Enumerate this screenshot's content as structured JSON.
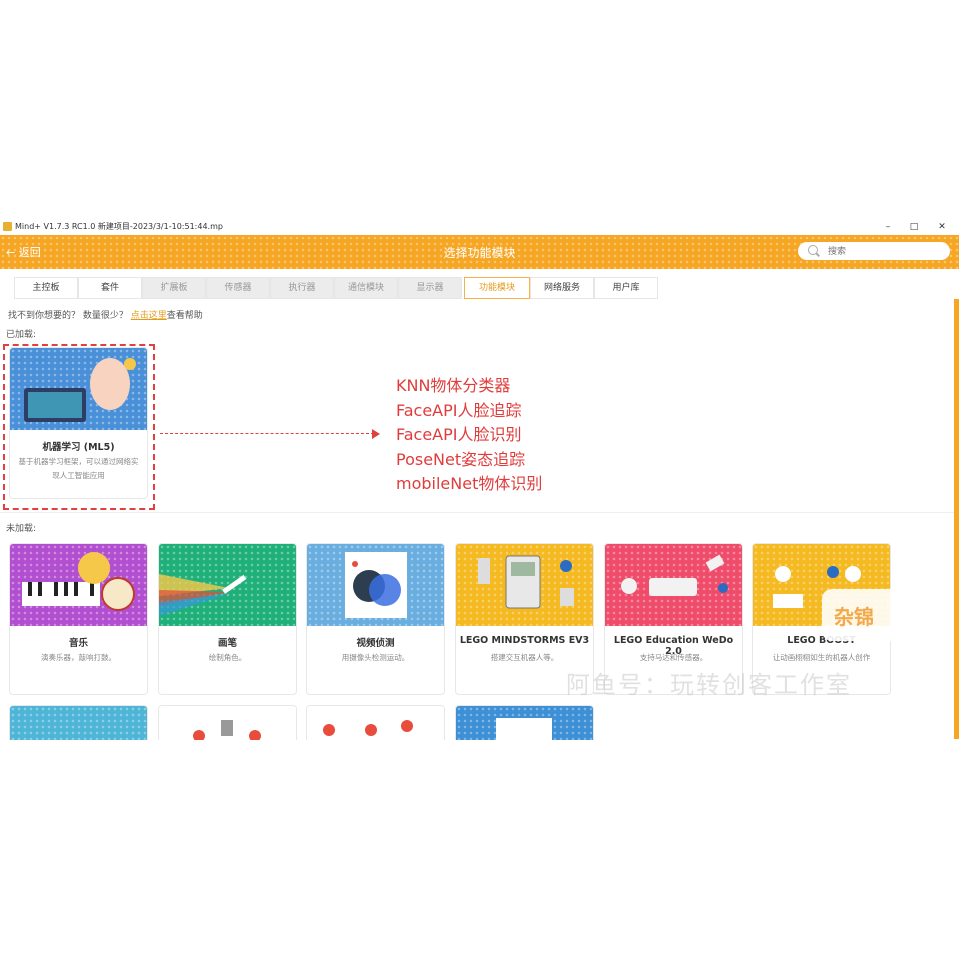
{
  "window": {
    "title": "Mind+ V1.7.3 RC1.0   新建项目-2023/3/1-10:51:44.mp",
    "minimize": "–",
    "maximize": "□",
    "close": "✕"
  },
  "header": {
    "back_label": "← 返回",
    "title": "选择功能模块",
    "search_placeholder": "搜索"
  },
  "tabs": [
    {
      "label": "主控板",
      "state": "normal"
    },
    {
      "label": "套件",
      "state": "normal"
    },
    {
      "label": "扩展板",
      "state": "disabled"
    },
    {
      "label": "传感器",
      "state": "disabled"
    },
    {
      "label": "执行器",
      "state": "disabled"
    },
    {
      "label": "通信模块",
      "state": "disabled"
    },
    {
      "label": "显示器",
      "state": "disabled"
    },
    {
      "label": "功能模块",
      "state": "active"
    },
    {
      "label": "网络服务",
      "state": "normal"
    },
    {
      "label": "用户库",
      "state": "normal"
    }
  ],
  "hint": {
    "prefix": "找不到你想要的？ 数量很少？",
    "link": "点击这里",
    "suffix": "查看帮助"
  },
  "loaded_label": "已加载:",
  "unloaded_label": "未加载:",
  "loaded_cards": [
    {
      "name": "机器学习 (ML5)",
      "desc": "基于机器学习框架，可以通过网络实现人工智能应用",
      "color": "#4a90d9"
    }
  ],
  "annotation_lines": [
    "KNN物体分类器",
    "FaceAPI人脸追踪",
    "FaceAPI人脸识别",
    "PoseNet姿态追踪",
    "mobileNet物体识别"
  ],
  "cards": [
    {
      "name": "音乐",
      "desc": "演奏乐器，敲响打鼓。",
      "color": "#b24fd0"
    },
    {
      "name": "画笔",
      "desc": "绘制角色。",
      "color": "#1fb07a"
    },
    {
      "name": "视频侦测",
      "desc": "用摄像头检测运动。",
      "color": "#6aaee0"
    },
    {
      "name": "LEGO MINDSTORMS EV3",
      "desc": "搭建交互机器人等。",
      "color": "#f5b921"
    },
    {
      "name": "LEGO Education WeDo 2.0",
      "desc": "支持马达和传感器。",
      "color": "#ef4b6a"
    },
    {
      "name": "LEGO BOOST",
      "desc": "让动画栩栩如生的机器人创作",
      "color": "#f5b921"
    }
  ],
  "cards_row3_colors": [
    "#4fb5d6",
    "#ffffff",
    "#ffffff",
    "#3d8fd6"
  ],
  "watermark": {
    "text": "阿鱼号：玩转创客工作室",
    "logo": "杂锦"
  },
  "colors": {
    "accent": "#f6a623",
    "annotation": "#e03c3c"
  }
}
